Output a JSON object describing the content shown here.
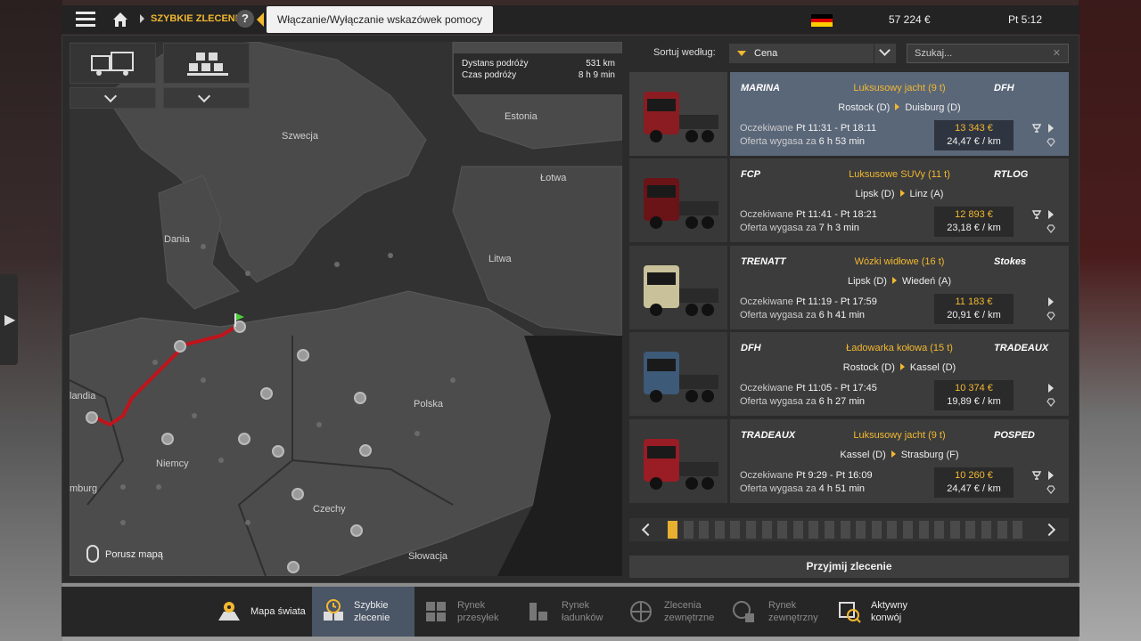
{
  "topbar": {
    "breadcrumb": "SZYBKIE ZLECENIA",
    "help_label": "?",
    "tooltip": "Włączanie/Wyłączanie wskazówek pomocy",
    "flag_colors": [
      "#000000",
      "#dd0000",
      "#ffce00"
    ],
    "money": "57 224 €",
    "time": "Pt 5:12"
  },
  "map": {
    "route_info": {
      "distance_label": "Dystans podróży",
      "distance_value": "531 km",
      "time_label": "Czas podróży",
      "time_value": "8 h 9 min"
    },
    "labels": {
      "szwecja": "Szwecja",
      "estonia": "Estonia",
      "lotwa": "Łotwa",
      "dania": "Dania",
      "litwa": "Litwa",
      "polska": "Polska",
      "niemcy": "Niemcy",
      "czechy": "Czechy",
      "slowacja": "Słowacja",
      "holandia": "landia",
      "hamburg": "mburg"
    },
    "move_hint": "Porusz mapą",
    "route_color": "#c0141c"
  },
  "sort": {
    "label": "Sortuj według:",
    "value": "Cena",
    "search_placeholder": "Szukaj..."
  },
  "jobs": [
    {
      "company": "MARINA",
      "cargo": "Luksusowy jacht (9 t)",
      "from": "Rostock (D)",
      "to": "Duisburg (D)",
      "expected_label": "Oczekiwane",
      "expected": "Pt 11:31 - Pt 18:11",
      "expires_label": "Oferta wygasa za",
      "expires": "6 h 53 min",
      "price": "13 343 €",
      "per_km": "24,47 € / km",
      "recipient": "DFH",
      "truck_color": "#8a1c22"
    },
    {
      "company": "FCP",
      "cargo": "Luksusowe SUVy (11 t)",
      "from": "Lipsk (D)",
      "to": "Linz (A)",
      "expected_label": "Oczekiwane",
      "expected": "Pt 11:41 - Pt 18:21",
      "expires_label": "Oferta wygasa za",
      "expires": "7 h 3 min",
      "price": "12 893 €",
      "per_km": "23,18 € / km",
      "recipient": "RTLOG",
      "truck_color": "#6a1418"
    },
    {
      "company": "TRENATT",
      "cargo": "Wózki widłowe (16 t)",
      "from": "Lipsk (D)",
      "to": "Wiedeń (A)",
      "expected_label": "Oczekiwane",
      "expected": "Pt 11:19 - Pt 17:59",
      "expires_label": "Oferta wygasa za",
      "expires": "6 h 41 min",
      "price": "11 183 €",
      "per_km": "20,91 € / km",
      "recipient": "Stokes",
      "truck_color": "#c9c199"
    },
    {
      "company": "DFH",
      "cargo": "Ładowarka kołowa (15 t)",
      "from": "Rostock (D)",
      "to": "Kassel (D)",
      "expected_label": "Oczekiwane",
      "expected": "Pt 11:05 - Pt 17:45",
      "expires_label": "Oferta wygasa za",
      "expires": "6 h 27 min",
      "price": "10 374 €",
      "per_km": "19,89 € / km",
      "recipient": "TRADEAUX",
      "truck_color": "#3d5a78"
    },
    {
      "company": "TRADEAUX",
      "cargo": "Luksusowy jacht (9 t)",
      "from": "Kassel (D)",
      "to": "Strasburg (F)",
      "expected_label": "Oczekiwane",
      "expected": "Pt 9:29 - Pt 16:09",
      "expires_label": "Oferta wygasa za",
      "expires": "4 h 51 min",
      "price": "10 260 €",
      "per_km": "24,47 € / km",
      "recipient": "POSPED",
      "truck_color": "#9a1c24"
    }
  ],
  "accept_label": "Przyjmij zlecenie",
  "nav": {
    "map": "Mapa świata",
    "quick_1": "Szybkie",
    "quick_2": "zlecenie",
    "freight_1": "Rynek",
    "freight_2": "przesyłek",
    "cargo_1": "Rynek",
    "cargo_2": "ładunków",
    "external_1": "Zlecenia",
    "external_2": "zewnętrzne",
    "extmarket_1": "Rynek",
    "extmarket_2": "zewnętrzny",
    "convoy_1": "Aktywny",
    "convoy_2": "konwój"
  },
  "colors": {
    "accent": "#f2b830",
    "selected_row": "#5a6779",
    "active_nav": "#4a5566"
  }
}
